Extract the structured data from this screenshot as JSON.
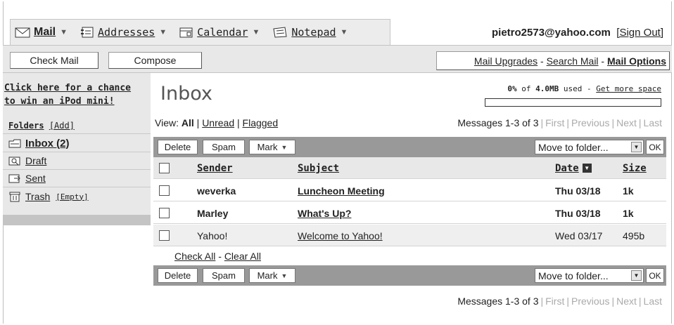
{
  "nav": {
    "tabs": [
      {
        "label": "Mail",
        "icon": "envelope-icon"
      },
      {
        "label": "Addresses",
        "icon": "address-book-icon"
      },
      {
        "label": "Calendar",
        "icon": "calendar-icon"
      },
      {
        "label": "Notepad",
        "icon": "notepad-icon"
      }
    ],
    "account_email": "pietro2573@yahoo.com",
    "sign_out": "[Sign Out]"
  },
  "toolbar": {
    "check_mail": "Check Mail",
    "compose": "Compose",
    "mail_upgrades": "Mail Upgrades",
    "search_mail": "Search Mail",
    "mail_options": "Mail Options",
    "separator": " - "
  },
  "sidebar": {
    "promo_line1": "Click here for a chance",
    "promo_line2": "to win an iPod mini!",
    "folders_label": "Folders",
    "folders_add": "[Add]",
    "folders": [
      {
        "label": "Inbox (2)",
        "icon": "inbox-folder-icon"
      },
      {
        "label": "Draft",
        "icon": "draft-folder-icon"
      },
      {
        "label": "Sent",
        "icon": "sent-folder-icon"
      },
      {
        "label": "Trash",
        "icon": "trash-icon"
      }
    ],
    "trash_empty": "[Empty]"
  },
  "main": {
    "title": "Inbox",
    "quota": {
      "percent": "0%",
      "of": "of",
      "total": "4.0MB",
      "used": "used -",
      "more_space": "Get more space",
      "fill_fraction": 0.0
    },
    "view": {
      "label": "View:",
      "all": "All",
      "unread": "Unread",
      "flagged": "Flagged"
    },
    "pager": {
      "messages": "Messages 1-3 of 3",
      "first": "First",
      "previous": "Previous",
      "next": "Next",
      "last": "Last"
    },
    "actions": {
      "delete": "Delete",
      "spam": "Spam",
      "mark": "Mark",
      "move_to": "Move to folder...",
      "ok": "OK"
    },
    "columns": {
      "sender": "Sender",
      "subject": "Subject",
      "date": "Date",
      "size": "Size"
    },
    "messages": [
      {
        "sender": "weverka",
        "subject": "Luncheon Meeting",
        "date": "Thu 03/18",
        "size": "1k",
        "unread": true
      },
      {
        "sender": "Marley",
        "subject": "What's Up?",
        "date": "Thu 03/18",
        "size": "1k",
        "unread": true
      },
      {
        "sender": "Yahoo!",
        "subject": "Welcome to Yahoo!",
        "date": "Wed 03/17",
        "size": "495b",
        "unread": false
      }
    ],
    "check_all": "Check All",
    "clear_all": "Clear All",
    "check_sep": " - "
  }
}
